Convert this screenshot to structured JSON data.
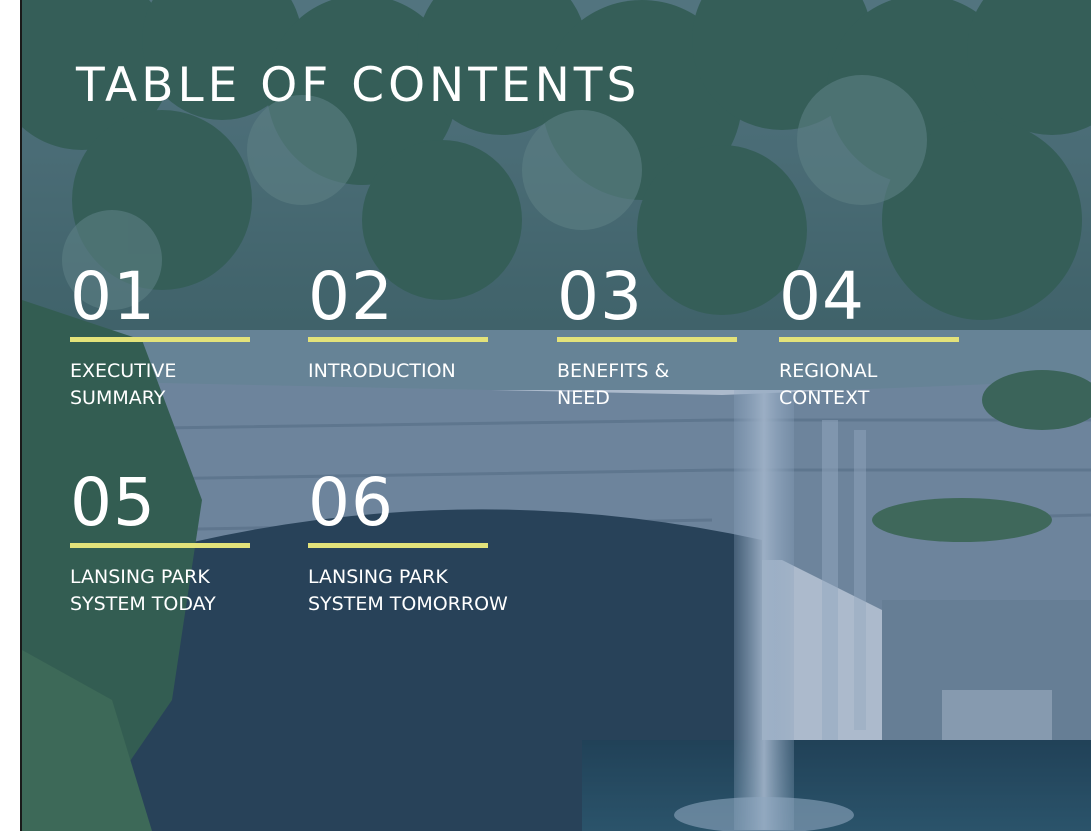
{
  "title": "TABLE OF CONTENTS",
  "accent_color": "#e3e27a",
  "overlay_color": "#264a7a",
  "sections": [
    {
      "number": "01",
      "label": "EXECUTIVE\nSUMMARY"
    },
    {
      "number": "02",
      "label": "INTRODUCTION"
    },
    {
      "number": "03",
      "label": "BENEFITS &\nNEED"
    },
    {
      "number": "04",
      "label": "REGIONAL\nCONTEXT"
    },
    {
      "number": "05",
      "label": "LANSING PARK\nSYSTEM TODAY"
    },
    {
      "number": "06",
      "label": "LANSING PARK\nSYSTEM TOMORROW"
    }
  ]
}
